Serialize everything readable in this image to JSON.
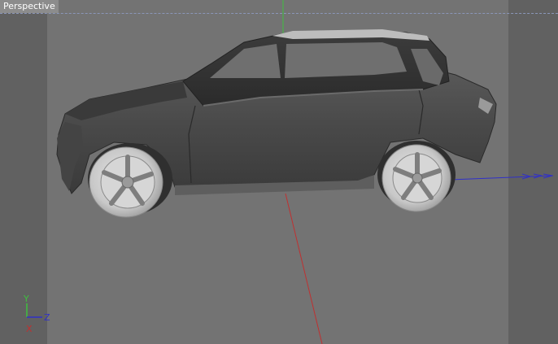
{
  "viewport": {
    "name": "Perspective",
    "gizmo": {
      "y_label": "Y",
      "z_label": "Z",
      "x_label": "X"
    },
    "colors": {
      "x_axis": "#c03030",
      "y_axis": "#3fbf3f",
      "z_axis": "#3030c8",
      "background": "#737373"
    }
  }
}
